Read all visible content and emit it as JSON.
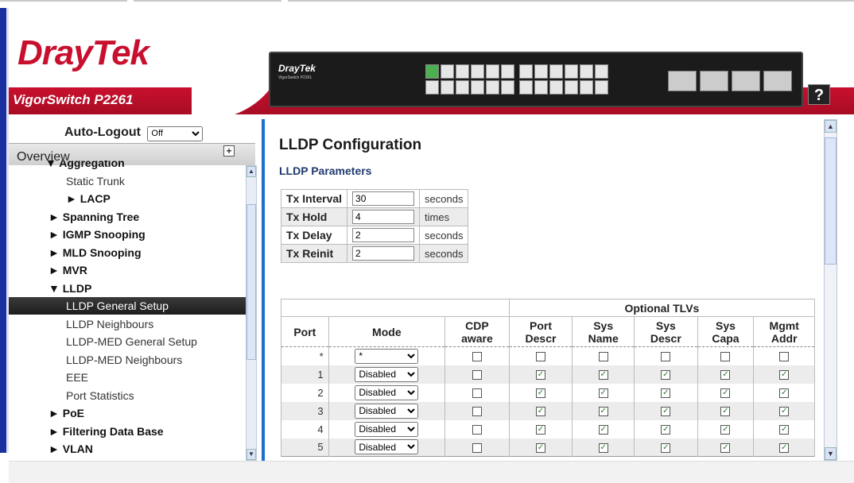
{
  "brand": {
    "dray": "Dray",
    "tek": "Tek",
    "model": "VigorSwitch P2261",
    "device_logo": "DrayTek",
    "device_sub": "VigorSwitch P2261",
    "help": "?"
  },
  "autologout": {
    "label": "Auto-Logout",
    "value": "Off"
  },
  "overview_label": "Overview",
  "nav": [
    {
      "label": "▼ Aggregation",
      "bold": true,
      "indent": 46
    },
    {
      "label": "Static Trunk",
      "bold": false,
      "indent": 72
    },
    {
      "label": "► LACP",
      "bold": true,
      "indent": 72
    },
    {
      "label": "► Spanning Tree",
      "bold": true,
      "indent": 50
    },
    {
      "label": "► IGMP Snooping",
      "bold": true,
      "indent": 50
    },
    {
      "label": "► MLD Snooping",
      "bold": true,
      "indent": 50
    },
    {
      "label": "► MVR",
      "bold": true,
      "indent": 50
    },
    {
      "label": "▼ LLDP",
      "bold": true,
      "indent": 50
    },
    {
      "label": "LLDP General Setup",
      "bold": false,
      "indent": 72,
      "selected": true
    },
    {
      "label": "LLDP Neighbours",
      "bold": false,
      "indent": 72
    },
    {
      "label": "LLDP-MED General Setup",
      "bold": false,
      "indent": 72
    },
    {
      "label": "LLDP-MED Neighbours",
      "bold": false,
      "indent": 72
    },
    {
      "label": "EEE",
      "bold": false,
      "indent": 72
    },
    {
      "label": "Port Statistics",
      "bold": false,
      "indent": 72
    },
    {
      "label": "► PoE",
      "bold": true,
      "indent": 50
    },
    {
      "label": "► Filtering Data Base",
      "bold": true,
      "indent": 50
    },
    {
      "label": "► VLAN",
      "bold": true,
      "indent": 50
    }
  ],
  "page": {
    "title": "LLDP Configuration",
    "subtitle": "LLDP Parameters"
  },
  "params": [
    {
      "label": "Tx Interval",
      "value": "30",
      "unit": "seconds"
    },
    {
      "label": "Tx Hold",
      "value": "4",
      "unit": "times"
    },
    {
      "label": "Tx Delay",
      "value": "2",
      "unit": "seconds"
    },
    {
      "label": "Tx Reinit",
      "value": "2",
      "unit": "seconds"
    }
  ],
  "table": {
    "group_header": "Optional TLVs",
    "headers": [
      "Port",
      "Mode",
      "CDP\naware",
      "Port\nDescr",
      "Sys\nName",
      "Sys\nDescr",
      "Sys\nCapa",
      "Mgmt\nAddr"
    ],
    "rows": [
      {
        "port": "*",
        "mode": "*",
        "checks": [
          false,
          false,
          false,
          false,
          false,
          false
        ]
      },
      {
        "port": "1",
        "mode": "Disabled",
        "checks": [
          false,
          true,
          true,
          true,
          true,
          true
        ]
      },
      {
        "port": "2",
        "mode": "Disabled",
        "checks": [
          false,
          true,
          true,
          true,
          true,
          true
        ]
      },
      {
        "port": "3",
        "mode": "Disabled",
        "checks": [
          false,
          true,
          true,
          true,
          true,
          true
        ]
      },
      {
        "port": "4",
        "mode": "Disabled",
        "checks": [
          false,
          true,
          true,
          true,
          true,
          true
        ]
      },
      {
        "port": "5",
        "mode": "Disabled",
        "checks": [
          false,
          true,
          true,
          true,
          true,
          true
        ]
      }
    ]
  }
}
